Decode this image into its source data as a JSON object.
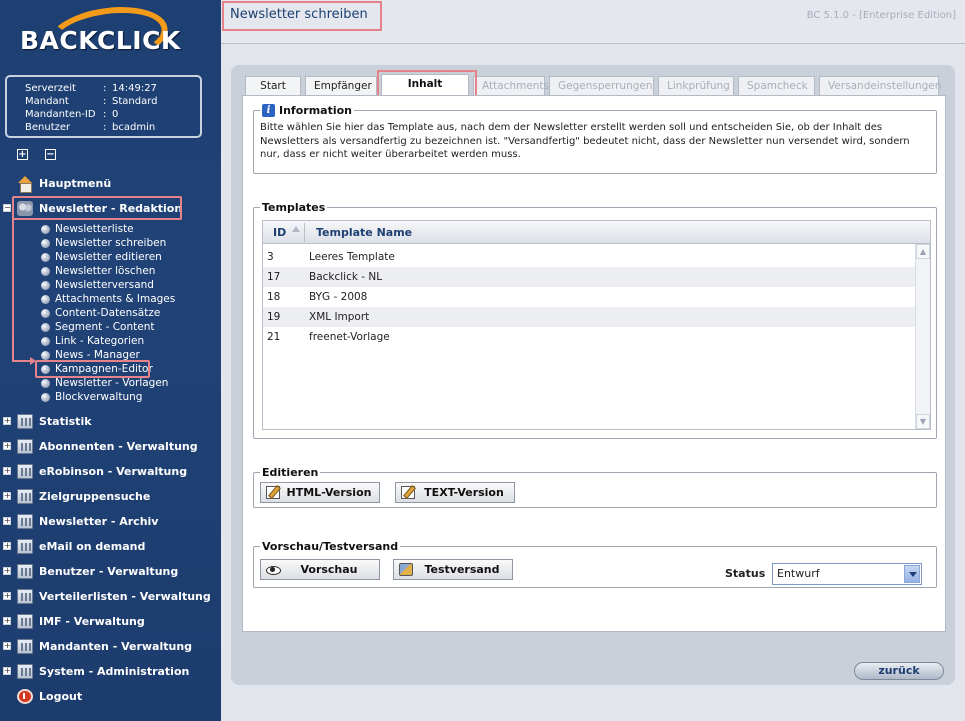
{
  "brand": {
    "logo_text": "BACKCLICK",
    "accent": "#f39a1a",
    "nav_bg": "#1e3f72",
    "highlight": "#e6828a"
  },
  "server_info": [
    {
      "key": "Serverzeit",
      "sep": ":",
      "value": "14:49:27"
    },
    {
      "key": "Mandant",
      "sep": ":",
      "value": "Standard"
    },
    {
      "key": "Mandanten-ID",
      "sep": ":",
      "value": "0"
    },
    {
      "key": "Benutzer",
      "sep": ":",
      "value": "bcadmin"
    }
  ],
  "tree_controls": {
    "expand": "+",
    "collapse": "−"
  },
  "nav": {
    "hauptmenu": "Hauptmenü",
    "redaktion": "Newsletter - Redaktion",
    "sub": [
      "Newsletterliste",
      "Newsletter schreiben",
      "Newsletter editieren",
      "Newsletter löschen",
      "Newsletterversand",
      "Attachments & Images",
      "Content-Datensätze",
      "Segment - Content",
      "Link - Kategorien",
      "News - Manager",
      "Kampagnen-Editor",
      "Newsletter - Vorlagen",
      "Blockverwaltung"
    ],
    "groups": [
      "Statistik",
      "Abonnenten - Verwaltung",
      "eRobinson - Verwaltung",
      "Zielgruppensuche",
      "Newsletter - Archiv",
      "eMail on demand",
      "Benutzer - Verwaltung",
      "Verteilerlisten - Verwaltung",
      "IMF - Verwaltung",
      "Mandanten - Verwaltung",
      "System - Administration"
    ],
    "logout": "Logout",
    "plus": "+",
    "minus": "−"
  },
  "header": {
    "title": "Newsletter schreiben",
    "version": "BC 5.1.0 - [Enterprise Edition]"
  },
  "tabs": [
    {
      "label": "Start",
      "state": "normal"
    },
    {
      "label": "Empfänger",
      "state": "normal"
    },
    {
      "label": "Inhalt",
      "state": "active"
    },
    {
      "label": "Attachments",
      "state": "disabled"
    },
    {
      "label": "Gegensperrungen",
      "state": "disabled"
    },
    {
      "label": "Linkprüfung",
      "state": "disabled"
    },
    {
      "label": "Spamcheck",
      "state": "disabled"
    },
    {
      "label": "Versandeinstellungen",
      "state": "disabled"
    }
  ],
  "information": {
    "legend": "Information",
    "icon": "i",
    "text": "Bitte wählen Sie hier das Template aus, nach dem der Newsletter erstellt werden soll und entscheiden Sie, ob der Inhalt des Newsletters als versandfertig zu bezeichnen ist. \"Versandfertig\" bedeutet nicht, dass der Newsletter nun versendet wird, sondern nur, dass er nicht weiter überarbeitet werden muss."
  },
  "templates": {
    "legend": "Templates",
    "columns": {
      "id": "ID",
      "name": "Template Name"
    },
    "rows": [
      {
        "id": "3",
        "name": "Leeres Template"
      },
      {
        "id": "17",
        "name": "Backclick - NL"
      },
      {
        "id": "18",
        "name": "BYG - 2008"
      },
      {
        "id": "19",
        "name": "XML Import"
      },
      {
        "id": "21",
        "name": "freenet-Vorlage"
      }
    ],
    "scroll_up": "▲",
    "scroll_down": "▼"
  },
  "edit": {
    "legend": "Editieren",
    "html_label": "HTML-Version",
    "text_label": "TEXT-Version"
  },
  "preview": {
    "legend": "Vorschau/Testversand",
    "preview_label": "Vorschau",
    "test_label": "Testversand",
    "status_label": "Status",
    "status_value": "Entwurf"
  },
  "back_label": "zurück"
}
